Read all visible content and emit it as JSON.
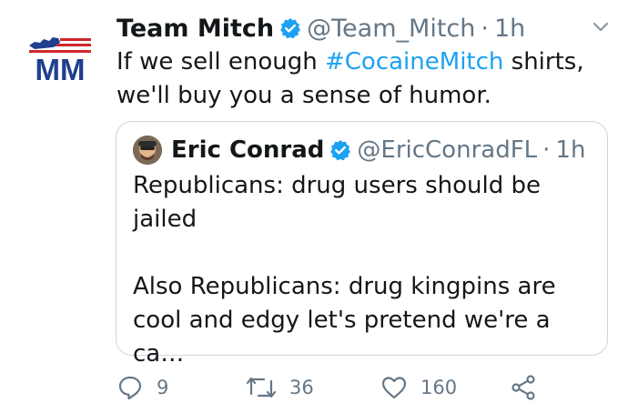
{
  "tweet": {
    "author_name": "Team Mitch",
    "handle": "@Team_Mitch",
    "dot": "·",
    "time": "1h",
    "text_before": "If we sell enough ",
    "hashtag": "#CocaineMitch",
    "text_after": " shirts, we'll buy you a sense of humor."
  },
  "logo": {
    "text": "MM",
    "color_blue": "#1f3f8f",
    "color_red": "#d0282f"
  },
  "quoted": {
    "author_name": "Eric Conrad",
    "handle": "@EricConradFL",
    "dot": "·",
    "time": "1h",
    "line1": "Republicans: drug users should be jailed",
    "line2": "Also Republicans: drug kingpins are cool and edgy let's pretend we're a ca…"
  },
  "actions": {
    "reply_count": "9",
    "retweet_count": "36",
    "like_count": "160"
  },
  "icons": [
    "verified-badge-icon",
    "caret-down-icon",
    "reply-icon",
    "retweet-icon",
    "like-icon",
    "share-icon"
  ],
  "colors": {
    "link": "#1da1f2",
    "muted": "#657786",
    "border": "#ccd6dd"
  }
}
